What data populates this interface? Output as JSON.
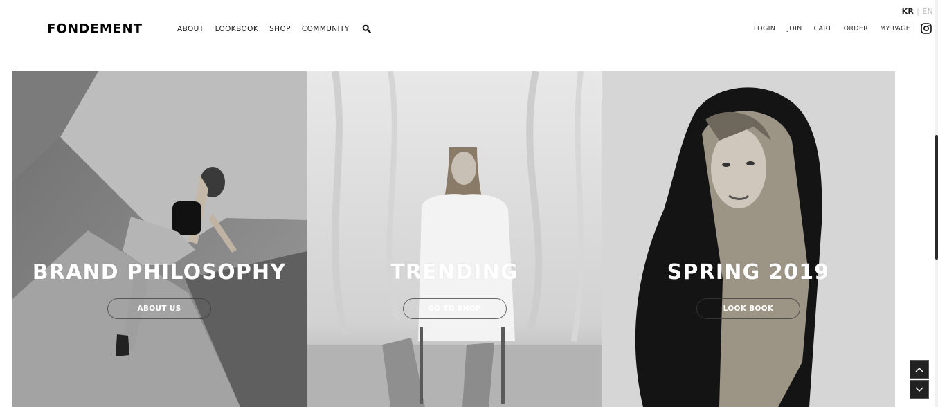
{
  "lang": {
    "kr": "KR",
    "separator": "|",
    "en": "EN"
  },
  "header": {
    "logo": "FONDEMENT",
    "nav": [
      "ABOUT",
      "LOOKBOOK",
      "SHOP",
      "COMMUNITY"
    ],
    "search_icon": "search-icon",
    "util": [
      "LOGIN",
      "JOIN",
      "CART",
      "ORDER",
      "MY PAGE"
    ],
    "instagram_icon": "instagram-icon"
  },
  "panels": [
    {
      "title": "BRAND PHILOSOPHY",
      "button": "ABOUT US"
    },
    {
      "title": "TRENDING",
      "button": "GO TO SHOP"
    },
    {
      "title": "SPRING 2019",
      "button": "LOOK BOOK"
    }
  ],
  "scroll": {
    "up_icon": "chevron-up-icon",
    "down_icon": "chevron-down-icon"
  }
}
